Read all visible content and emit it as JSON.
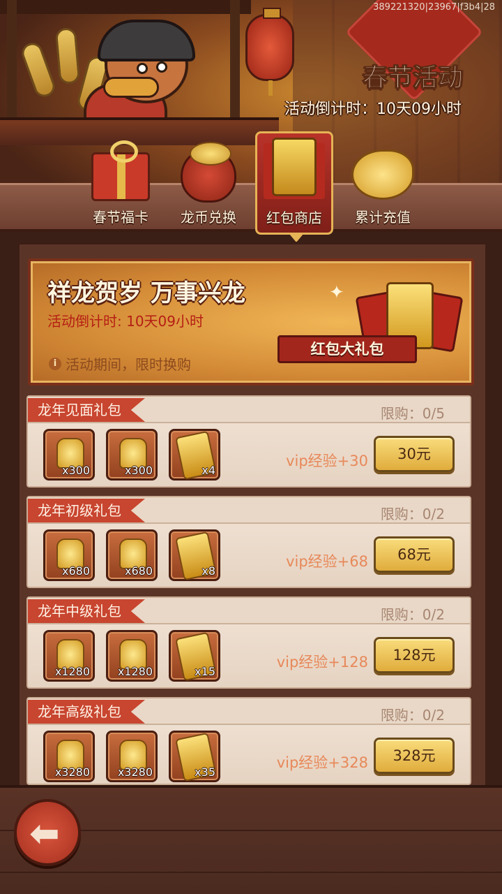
{
  "build_id": "389221320|23967|f3b4|28",
  "header": {
    "title": "春节活动",
    "countdown": "活动倒计时：10天09小时"
  },
  "tabs": [
    {
      "label": "春节福卡",
      "icon": "gift-box-icon",
      "active": false
    },
    {
      "label": "龙币兑换",
      "icon": "coin-bag-icon",
      "active": false
    },
    {
      "label": "红包商店",
      "icon": "red-envelope-icon",
      "active": true
    },
    {
      "label": "累计充值",
      "icon": "golden-dragon-icon",
      "active": false
    }
  ],
  "banner": {
    "title": "祥龙贺岁 万事兴龙",
    "countdown": "活动倒计时: 10天09小时",
    "note": "活动期间，限时换购",
    "badge": "红包大礼包"
  },
  "packs": [
    {
      "name": "龙年见面礼包",
      "limit": "限购：0/5",
      "items": [
        {
          "icon": "gold-ingot-icon",
          "qty": "x300"
        },
        {
          "icon": "gold-ingot-icon",
          "qty": "x300"
        },
        {
          "icon": "gold-envelope-icon",
          "qty": "x4"
        }
      ],
      "vip": "vip经验+30",
      "price": "30元"
    },
    {
      "name": "龙年初级礼包",
      "limit": "限购：0/2",
      "items": [
        {
          "icon": "gold-ingot-icon",
          "qty": "x680"
        },
        {
          "icon": "gold-ingot-icon",
          "qty": "x680"
        },
        {
          "icon": "gold-envelope-icon",
          "qty": "x8"
        }
      ],
      "vip": "vip经验+68",
      "price": "68元"
    },
    {
      "name": "龙年中级礼包",
      "limit": "限购：0/2",
      "items": [
        {
          "icon": "gold-ingot-icon",
          "qty": "x1280"
        },
        {
          "icon": "gold-ingot-icon",
          "qty": "x1280"
        },
        {
          "icon": "gold-envelope-icon",
          "qty": "x15"
        }
      ],
      "vip": "vip经验+128",
      "price": "128元"
    },
    {
      "name": "龙年高级礼包",
      "limit": "限购：0/2",
      "items": [
        {
          "icon": "gold-ingot-icon",
          "qty": "x3280"
        },
        {
          "icon": "gold-ingot-icon",
          "qty": "x3280"
        },
        {
          "icon": "gold-envelope-icon",
          "qty": "x35"
        }
      ],
      "vip": "vip经验+328",
      "price": "328元"
    }
  ],
  "footer": {
    "back_icon": "back-arrow-icon"
  },
  "colors": {
    "accent_red": "#c8452f",
    "gold": "#e0ac3c",
    "panel_bg": "#5b3428"
  }
}
